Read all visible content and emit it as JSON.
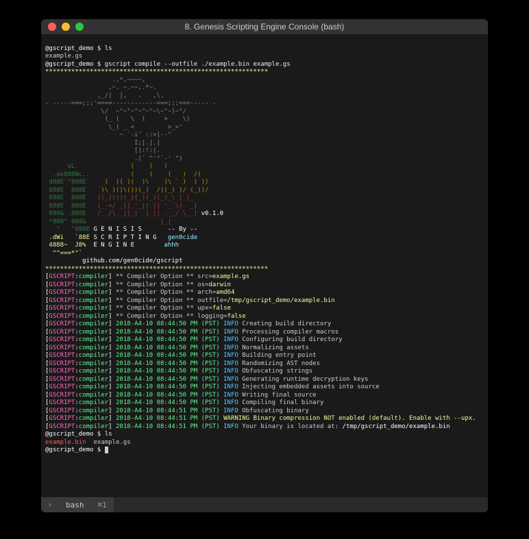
{
  "window": {
    "title": "8. Genesis Scripting Engine Console (bash)"
  },
  "prompt_user": "@gscript_demo",
  "prompt_symbol": "$",
  "commands": {
    "ls1": "ls",
    "compile": "gscript compile --outfile ./example.bin example.gs",
    "ls2": "ls"
  },
  "ls1_output": "example.gs",
  "banner_stars": "************************************************************",
  "ascii_art": {
    "l01": "                  .,*,~~~~,",
    "l02": "                 ,~. ~.~~,.*~.",
    "l03": "              ,_/|  |,   .   ,\\.",
    "l04": "- -----===;;;'====------------===;;;===----- -",
    "l05": "               \\/  ~\"~\"~\"~\"~\"~\\~\"~)~\"/",
    "l06": "                (_ (   \\  (     >    \\)",
    "l07": "                 \\_( _ <         >_>'",
    "l08": "                    ~ `-i' ::>|--\"",
    "l09": "                        I;|.|.|",
    "l10": "                        [|:!:|.",
    "l11": "                        .(` ^'\"`-' \")"
  },
  "logo": {
    "l1a": "      uL   ",
    "l1b": "            (    (   (",
    "l2a": "  .ue888Nc..",
    "l2b": "           (    (    (   )  /(",
    "l3a": " d88E`\"888E`",
    "l3b": "    )  (( )(  )\\    )\\ ` )  ) ))",
    "l4a": " 888E  888E",
    "l4b": "    )\\ )()\\())(_)  /((_) )/ (_))/",
    "l5a": " 888E  888E",
    "l5b": "   ((_)(()(_)(_)(_)(_)_\\ | |_",
    "l6a": " 888E  888E",
    "l6b": "   (_-</ _|| '_|| || '_ \\|  _|",
    "l7a": " 888& .888E",
    "l7b": "   /__/\\__||_|  |_|| .__/ \\__|",
    "l7v": " v0.1.0",
    "l8a": " *888\" 888&",
    "l8b": "                    |_|",
    "l9a": "  `\"   \"888E",
    "l9b": " G E N I S I S       -- By --",
    "l10a": " .dWi   `88E",
    "l10b": " S C R I P T I N G   ",
    "l10c": "gen0cide",
    "l11a": " 4888~  J8%",
    "l11b": "  E N G I N E        ",
    "l11c": "ahhh",
    "l12a": "  ^\"===*\"`",
    "url": "          github.com/gen0cide/gscript"
  },
  "options": [
    {
      "key": "src",
      "val": "example.gs"
    },
    {
      "key": "os",
      "val": "darwin"
    },
    {
      "key": "arch",
      "val": "amd64"
    },
    {
      "key": "outfile",
      "val": "/tmp/gscript_demo/example.bin"
    },
    {
      "key": "upx",
      "val": "false"
    },
    {
      "key": "logging",
      "val": "false"
    }
  ],
  "log_prefix": {
    "open": "[",
    "gscript": "GSCRIPT",
    "sep": ":",
    "compiler": "compiler",
    "close": "]"
  },
  "log_ts": "2018-A4-10 08:44:50 PM (PST)",
  "log_ts2": "2018-A4-10 08:44:51 PM (PST)",
  "info": "INFO",
  "warn": "WARNING",
  "info_lines": [
    "Creating build directory",
    "Processing compiler macros",
    "Configuring build directory",
    "Normalizing assets",
    "Building entry point",
    "Randomizing AST nodes",
    "Obfuscating strings",
    "Generating runtime decryption keys",
    "Injecting embedded assets into source",
    "Writing final source",
    "Compiling final binary",
    "Obfuscating binary"
  ],
  "warn_line": "Binary compression NOT enabled (default). Enable with --upx.",
  "final_line_a": "Your binary is located at: ",
  "final_line_b": "/tmp/gscript_demo/example.bin",
  "ls2_output": {
    "bin": "example.bin",
    "gs": "example.gs"
  },
  "statusbar": {
    "tab_name": "bash",
    "tab_key": "⌘1"
  }
}
